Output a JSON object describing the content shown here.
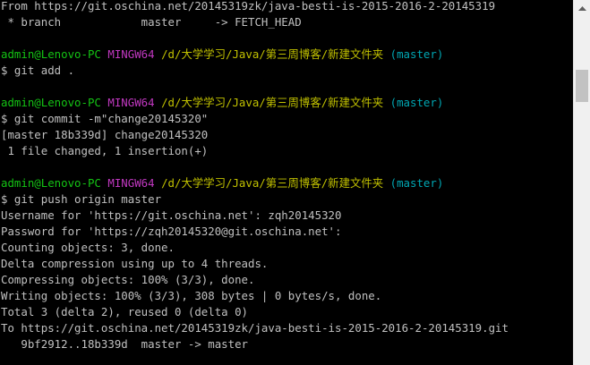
{
  "terminal": {
    "lines": [
      {
        "segments": [
          {
            "text": "From https://git.oschina.net/20145319zk/java-besti-is-2015-2016-2-20145319",
            "color": "white"
          }
        ]
      },
      {
        "segments": [
          {
            "text": " * branch            master     -> FETCH_HEAD",
            "color": "white"
          }
        ]
      },
      {
        "segments": [
          {
            "text": "",
            "color": "white"
          }
        ]
      },
      {
        "segments": [
          {
            "text": "admin@Lenovo-PC",
            "color": "green"
          },
          {
            "text": " ",
            "color": "white"
          },
          {
            "text": "MINGW64",
            "color": "purple"
          },
          {
            "text": " ",
            "color": "white"
          },
          {
            "text": "/d/大学学习/Java/第三周博客/新建文件夹",
            "color": "yellow"
          },
          {
            "text": " ",
            "color": "white"
          },
          {
            "text": "(master)",
            "color": "cyan"
          }
        ]
      },
      {
        "segments": [
          {
            "text": "$ git add .",
            "color": "white"
          }
        ]
      },
      {
        "segments": [
          {
            "text": "",
            "color": "white"
          }
        ]
      },
      {
        "segments": [
          {
            "text": "admin@Lenovo-PC",
            "color": "green"
          },
          {
            "text": " ",
            "color": "white"
          },
          {
            "text": "MINGW64",
            "color": "purple"
          },
          {
            "text": " ",
            "color": "white"
          },
          {
            "text": "/d/大学学习/Java/第三周博客/新建文件夹",
            "color": "yellow"
          },
          {
            "text": " ",
            "color": "white"
          },
          {
            "text": "(master)",
            "color": "cyan"
          }
        ]
      },
      {
        "segments": [
          {
            "text": "$ git commit -m\"change20145320\"",
            "color": "white"
          }
        ]
      },
      {
        "segments": [
          {
            "text": "[master 18b339d] change20145320",
            "color": "white"
          }
        ]
      },
      {
        "segments": [
          {
            "text": " 1 file changed, 1 insertion(+)",
            "color": "white"
          }
        ]
      },
      {
        "segments": [
          {
            "text": "",
            "color": "white"
          }
        ]
      },
      {
        "segments": [
          {
            "text": "admin@Lenovo-PC",
            "color": "green"
          },
          {
            "text": " ",
            "color": "white"
          },
          {
            "text": "MINGW64",
            "color": "purple"
          },
          {
            "text": " ",
            "color": "white"
          },
          {
            "text": "/d/大学学习/Java/第三周博客/新建文件夹",
            "color": "yellow"
          },
          {
            "text": " ",
            "color": "white"
          },
          {
            "text": "(master)",
            "color": "cyan"
          }
        ]
      },
      {
        "segments": [
          {
            "text": "$ git push origin master",
            "color": "white"
          }
        ]
      },
      {
        "segments": [
          {
            "text": "Username for 'https://git.oschina.net': zqh20145320",
            "color": "white"
          }
        ]
      },
      {
        "segments": [
          {
            "text": "Password for 'https://zqh20145320@git.oschina.net':",
            "color": "white"
          }
        ]
      },
      {
        "segments": [
          {
            "text": "Counting objects: 3, done.",
            "color": "white"
          }
        ]
      },
      {
        "segments": [
          {
            "text": "Delta compression using up to 4 threads.",
            "color": "white"
          }
        ]
      },
      {
        "segments": [
          {
            "text": "Compressing objects: 100% (3/3), done.",
            "color": "white"
          }
        ]
      },
      {
        "segments": [
          {
            "text": "Writing objects: 100% (3/3), 308 bytes | 0 bytes/s, done.",
            "color": "white"
          }
        ]
      },
      {
        "segments": [
          {
            "text": "Total 3 (delta 2), reused 0 (delta 0)",
            "color": "white"
          }
        ]
      },
      {
        "segments": [
          {
            "text": "To https://git.oschina.net/20145319zk/java-besti-is-2015-2016-2-20145319.git",
            "color": "white"
          }
        ]
      },
      {
        "segments": [
          {
            "text": "   9bf2912..18b339d  master -> master",
            "color": "white"
          }
        ]
      }
    ]
  },
  "scrollbar": {
    "up_icon": "triangle-up-icon",
    "position": 0.18
  },
  "colors": {
    "background": "#000000",
    "text": "#c0c0c0",
    "user_host": "#14c314",
    "msystem": "#c038c0",
    "path": "#c0c000",
    "branch": "#00a6b2"
  }
}
